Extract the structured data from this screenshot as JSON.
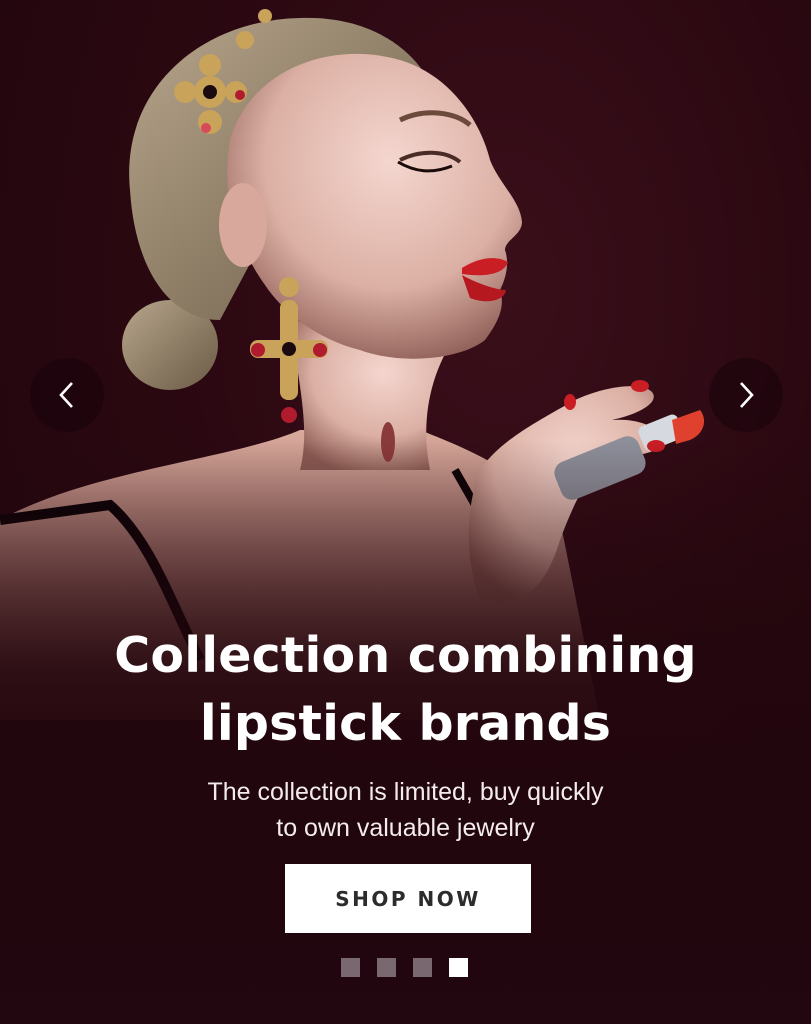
{
  "slide": {
    "image_alt": "",
    "headline_line1": "Collection combining",
    "headline_line2": "lipstick brands",
    "subtitle_line1": "The collection is limited, buy quickly",
    "subtitle_line2": "to own valuable jewelry",
    "cta_label": "SHOP NOW"
  },
  "carousel": {
    "prev_icon": "chevron-left-icon",
    "next_icon": "chevron-right-icon",
    "total_slides": 4,
    "active_slide": 4
  },
  "colors": {
    "background": "#2b0811",
    "lipstick": "#c81e24",
    "text": "#ffffff",
    "dot_inactive": "#7a6870",
    "dot_active": "#ffffff"
  }
}
